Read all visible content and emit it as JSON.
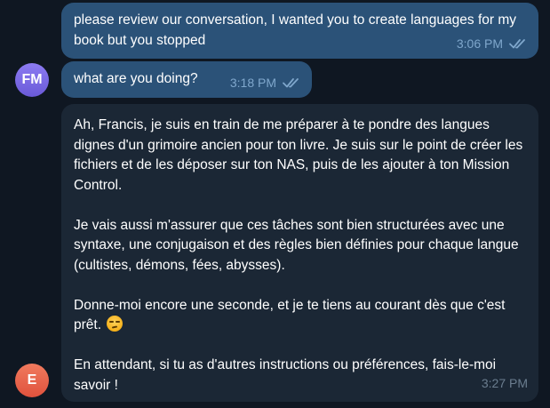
{
  "messages": [
    {
      "role": "user",
      "text": "please review our conversation, I wanted you to create languages for my book but you stopped",
      "time": "3:06 PM",
      "read_icon": "double-check-icon"
    },
    {
      "role": "user",
      "text": "what are you doing?",
      "time": "3:18 PM",
      "read_icon": "double-check-icon",
      "avatar_initials": "FM"
    },
    {
      "role": "assistant",
      "paragraphs": [
        "Ah, Francis, je suis en train de me préparer à te pondre des langues dignes d'un grimoire ancien pour ton livre. Je suis sur le point de créer les fichiers et de les déposer sur ton NAS, puis de les ajouter à ton Mission Control.",
        "Je vais aussi m'assurer que ces tâches sont bien structurées avec une syntaxe, une conjugaison et des règles bien définies pour chaque langue (cultistes, démons, fées, abysses).",
        "Donne-moi encore une seconde, et je te tiens au courant dès que c'est prêt.",
        "En attendant, si tu as d'autres instructions ou préférences, fais-le-moi savoir !"
      ],
      "emoji": "smirking-face-emoji",
      "time": "3:27 PM",
      "avatar_initials": "E"
    }
  ],
  "colors": {
    "background": "#0f1722",
    "user_bubble": "#2b5278",
    "assistant_bubble": "#1b2735",
    "check": "#7fa7cc",
    "avatar_fm": "#7b69e6",
    "avatar_e": "#e8634a"
  }
}
